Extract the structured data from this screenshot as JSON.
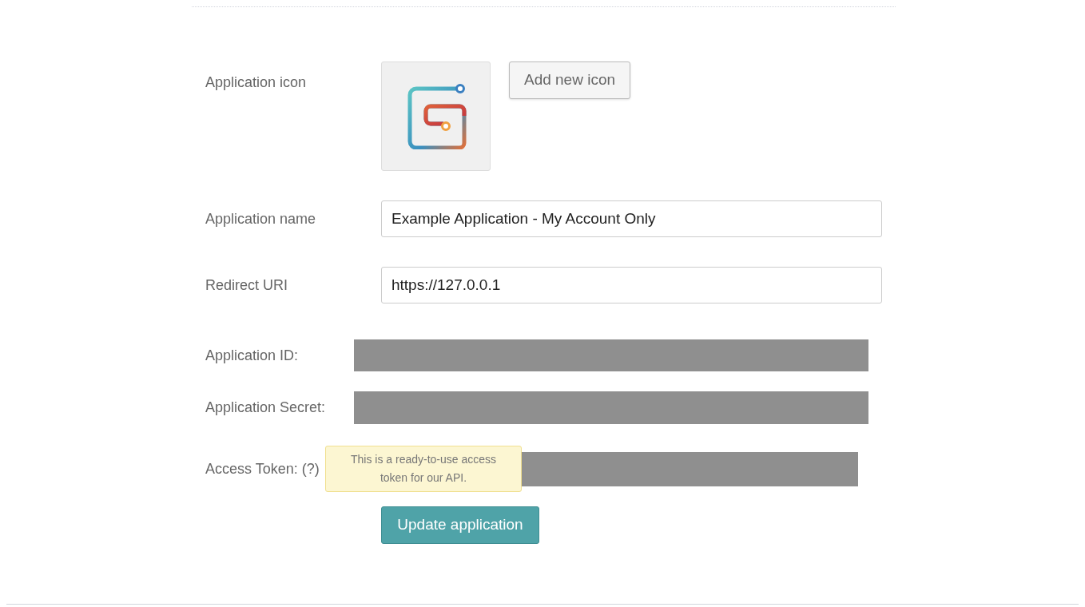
{
  "icon_row": {
    "label": "Application icon",
    "button": "Add new icon"
  },
  "fields": [
    {
      "label": "Application name",
      "value": "Example Application - My Account Only"
    },
    {
      "label": "Redirect URI",
      "value": "https://127.0.0.1"
    }
  ],
  "credentials": [
    {
      "label": "Application ID:",
      "redacted": true
    },
    {
      "label": "Application Secret:",
      "redacted": true
    },
    {
      "label": "Access Token: (?)",
      "redacted": true,
      "tooltip": "This is a ready-to-use access token for our API."
    }
  ],
  "submit_button": "Update application"
}
